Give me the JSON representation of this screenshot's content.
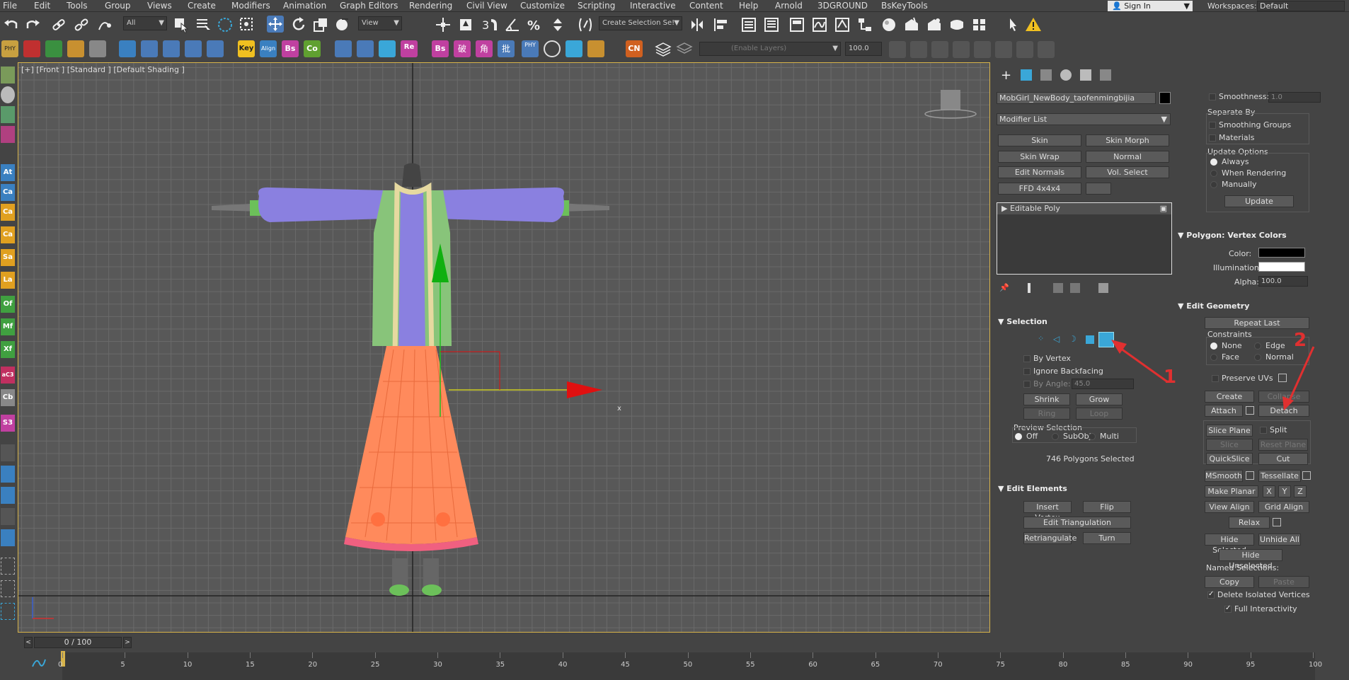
{
  "menu": [
    "File",
    "Edit",
    "Tools",
    "Group",
    "Views",
    "Create",
    "Modifiers",
    "Animation",
    "Graph Editors",
    "Rendering",
    "Civil View",
    "Customize",
    "Scripting",
    "Interactive",
    "Content",
    "Help",
    "Arnold",
    "3DGROUND",
    "BsKeyTools"
  ],
  "sign_in": "Sign In",
  "workspaces_label": "Workspaces:",
  "workspaces_value": "Default",
  "toolbar": {
    "filter": "All",
    "view": "View",
    "selection_set": "Create Selection Se!",
    "layers": "(Enable Layers)",
    "layer_value": "100.0"
  },
  "toolbar2_labels": [
    "PHY",
    "Key",
    "Align",
    "Bs",
    "Co",
    "Re",
    "Bs",
    "破",
    "角",
    "批",
    "PHY",
    "CN"
  ],
  "left_tools": [
    "At",
    "Ca",
    "Ca",
    "Sa",
    "La",
    "Of",
    "Mf",
    "Xf",
    "aC3",
    "Cb",
    "S3"
  ],
  "viewport": {
    "label": "[+] [Front ] [Standard ] [Default Shading ]",
    "gizmo_x": "x"
  },
  "object_name": "MobGirl_NewBody_taofenmingbijia",
  "modifier_list": "Modifier List",
  "modifier_buttons": [
    "Skin",
    "Skin Morph",
    "Skin Wrap",
    "Normal",
    "Edit Normals",
    "Vol. Select",
    "FFD 4x4x4",
    ""
  ],
  "stack_item": "Editable Poly",
  "selection": {
    "title": "Selection",
    "by_vertex": "By Vertex",
    "ignore_backfacing": "Ignore Backfacing",
    "by_angle": "By Angle:",
    "by_angle_val": "45.0",
    "shrink": "Shrink",
    "grow": "Grow",
    "ring": "Ring",
    "loop": "Loop",
    "preview": "Preview Selection",
    "off": "Off",
    "subobj": "SubObj",
    "multi": "Multi",
    "status": "746 Polygons Selected"
  },
  "edit_elements": {
    "title": "Edit Elements",
    "insert_vertex": "Insert Vertex",
    "flip": "Flip",
    "edit_triangulation": "Edit Triangulation",
    "retriangulate": "Retriangulate",
    "turn": "Turn"
  },
  "smoothing": {
    "smoothness": "Smoothness:",
    "smoothness_val": "1.0",
    "separate_by": "Separate By",
    "smoothing_groups": "Smoothing Groups",
    "materials": "Materials",
    "update_options": "Update Options",
    "always": "Always",
    "when_rendering": "When Rendering",
    "manually": "Manually",
    "update": "Update"
  },
  "vertex_colors": {
    "title": "Polygon: Vertex Colors",
    "color": "Color:",
    "illumination": "Illumination:",
    "alpha": "Alpha:",
    "alpha_val": "100.0"
  },
  "edit_geometry": {
    "title": "Edit Geometry",
    "repeat_last": "Repeat Last",
    "constraints": "Constraints",
    "none": "None",
    "edge": "Edge",
    "face": "Face",
    "normal": "Normal",
    "preserve_uvs": "Preserve UVs",
    "create": "Create",
    "collapse": "Collapse",
    "attach": "Attach",
    "detach": "Detach",
    "slice_plane": "Slice Plane",
    "split": "Split",
    "slice": "Slice",
    "reset_plane": "Reset Plane",
    "quickslice": "QuickSlice",
    "cut": "Cut",
    "msmooth": "MSmooth",
    "tessellate": "Tessellate",
    "make_planar": "Make Planar",
    "x": "X",
    "y": "Y",
    "z": "Z",
    "view_align": "View Align",
    "grid_align": "Grid Align",
    "relax": "Relax",
    "hide_selected": "Hide Selected",
    "unhide_all": "Unhide All",
    "hide_unselected": "Hide Unselected",
    "named_selections": "Named Selections:",
    "copy": "Copy",
    "paste": "Paste",
    "delete_isolated": "Delete Isolated Vertices",
    "full_interactivity": "Full Interactivity"
  },
  "annotations": [
    "1",
    "2"
  ],
  "timeline": {
    "slider": "0 / 100",
    "ticks": [
      "0",
      "5",
      "10",
      "15",
      "20",
      "25",
      "30",
      "35",
      "40",
      "45",
      "50",
      "55",
      "60",
      "65",
      "70",
      "75",
      "80",
      "85",
      "90",
      "95",
      "100"
    ]
  },
  "colors": {
    "accent": "#3aa7d8",
    "viewport_border": "#d7b34a",
    "annotation": "#e03030"
  }
}
